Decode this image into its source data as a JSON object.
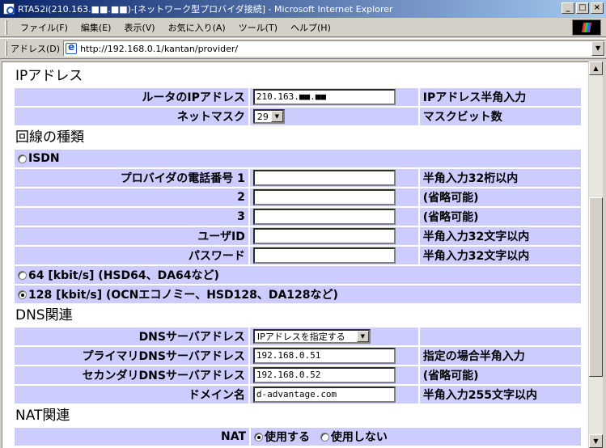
{
  "window": {
    "title": "RTA52i(210.163.■■.■■)-[ネットワーク型プロバイダ接続] - Microsoft Internet Explorer",
    "minimize": "_",
    "maximize": "□",
    "close": "×"
  },
  "menu": {
    "items": [
      "ファイル(F)",
      "編集(E)",
      "表示(V)",
      "お気に入り(A)",
      "ツール(T)",
      "ヘルプ(H)"
    ]
  },
  "address": {
    "label": "アドレス(D)",
    "url": "http://192.168.0.1/kantan/provider/"
  },
  "ip_section": {
    "heading": "IPアドレス",
    "router_ip_label": "ルータのIPアドレス",
    "router_ip_value": "210.163.■■.■■",
    "router_ip_note": "IPアドレス半角入力",
    "netmask_label": "ネットマスク",
    "netmask_value": "29",
    "netmask_note": "マスクビット数"
  },
  "line_section": {
    "heading": "回線の種類",
    "isdn_label": "ISDN",
    "phone_label": "プロバイダの電話番号 1",
    "phone_note_1": "半角入力32桁以内",
    "phone_2_label": "2",
    "phone_2_note": "(省略可能)",
    "phone_3_label": "3",
    "phone_3_note": "(省略可能)",
    "user_label": "ユーザID",
    "user_note": "半角入力32文字以内",
    "password_label": "パスワード",
    "password_note": "半角入力32文字以内",
    "opt64_label": "64 [kbit/s] (HSD64、DA64など)",
    "opt128_label": "128 [kbit/s] (OCNエコノミー、HSD128、DA128など)"
  },
  "dns_section": {
    "heading": "DNS関連",
    "server_label": "DNSサーバアドレス",
    "server_select": "IPアドレスを指定する",
    "primary_label": "プライマリDNSサーバアドレス",
    "primary_value": "192.168.0.51",
    "primary_note": "指定の場合半角入力",
    "secondary_label": "セカンダリDNSサーバアドレス",
    "secondary_value": "192.168.0.52",
    "secondary_note": "(省略可能)",
    "domain_label": "ドメイン名",
    "domain_value": "d-advantage.com",
    "domain_note": "半角入力255文字以内"
  },
  "nat_section": {
    "heading": "NAT関連",
    "nat_label": "NAT",
    "use_label": "使用する",
    "nouse_label": "使用しない"
  }
}
